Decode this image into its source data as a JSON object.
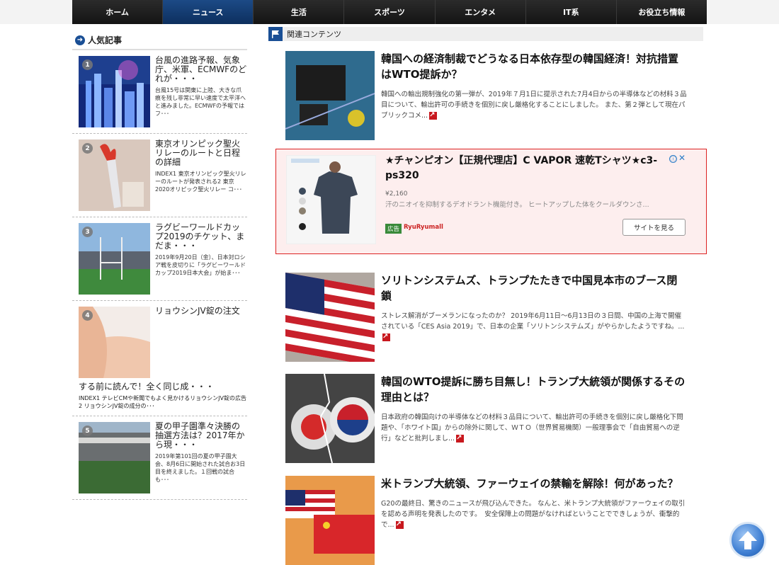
{
  "nav": {
    "items": [
      "ホーム",
      "ニュース",
      "生活",
      "スポーツ",
      "エンタメ",
      "IT系",
      "お役立ち情報"
    ],
    "active_index": 1
  },
  "sidebar": {
    "title": "人気記事",
    "items": [
      {
        "rank": "1",
        "title": "台風の進路予報、気象庁、米軍、ECMWFのどれが・・・",
        "desc": "台風15号は関東に上陸、大きな爪痕を残し非常に早い速度で太平洋へと進みました。ECMWFの予報ではフ･･･"
      },
      {
        "rank": "2",
        "title": "東京オリンピック聖火リレーのルートと日程の詳細",
        "desc": "INDEX1 東京オリンピック聖火リレーのルートが発表される2 東京2020オリピック聖火リレー コ･･･"
      },
      {
        "rank": "3",
        "title": "ラグビーワールドカップ2019のチケット、まだま・・・",
        "desc": "2019年9月20日（金）、日本対ロシア戦を皮切りに「ラグビーワールドカップ2019日本大会」が始ま･･･"
      },
      {
        "rank": "4",
        "title_line1": "リョウシンJV錠の注文",
        "title_line2": "する前に読んで！全く同じ成・・・",
        "desc": "INDEX1 テレビCMや新聞でもよく見かけるリョウシンJV錠の広告2 リョウシンJV錠の成分の･･･"
      },
      {
        "rank": "5",
        "title": "夏の甲子園準々決勝の抽選方法は？2017年から現・・・",
        "desc": "2019年第101回の夏の甲子園大会、8月6日に開始された試合お3日目を終えました。１回戦の試合も･･･"
      }
    ]
  },
  "main": {
    "title": "関連コンテンツ",
    "articles": [
      {
        "title": "韓国への経済制裁でどうなる日本依存型の韓国経済！対抗措置はWTO提訴か？",
        "desc": "韓国への輸出規制強化の第一弾が、2019年７月1日に提示された7月4日からの半導体などの材料３品目について、輸出許可の手続きを個別に戻し厳格化することにしました。 また、第２弾として現在パブリックコメ..."
      },
      {
        "title": "ソリトンシステムズ、トランプたたきで中国見本市のブース閉鎖",
        "desc": "ストレス解消がブーメランになったのか？ 2019年6月11日～6月13日の３日間、中国の上海で開催されている「CES Asia 2019」で、日本の企業「ソリトンシステムズ」がやらかしたようですね。..."
      },
      {
        "title": "韓国のWTO提訴に勝ち目無し！トランプ大統領が関係するその理由とは？",
        "desc": "日本政府の韓国向けの半導体などの材料３品目について、輸出許可の手続きを個別に戻し厳格化下問題や、「ホワイト国」からの除外に関して、ＷＴＯ（世界貿易機関）一般理事会で「自由貿易への逆行」などと批判しまし..."
      },
      {
        "title": "米トランプ大統領、ファーウェイの禁輸を解除！何があった？",
        "desc": "G20の最終日、驚きのニュースが飛び込んできた。 なんと、米トランプ大統領がファーウェイの取引を認める声明を発表したのです。　安全保障上の問題がなければということでできしょうが、衝撃的で..."
      }
    ]
  },
  "ad": {
    "title": "★チャンピオン【正規代理店】C VAPOR 速乾Tシャツ★c3-ps320",
    "price": "¥2,160",
    "desc": "汗のニオイを抑制するデオドラント機能付き。 ヒートアップした体をクールダウンさ...",
    "badge": "広告",
    "brand": "RyuRyumall",
    "button": "サイトを見る",
    "info": "ⓘ",
    "close": "✕"
  },
  "colors": {
    "nav_active": "#0d2f5e",
    "accent_blue": "#1a4f95",
    "ad_border": "#dd2222",
    "more_icon": "#c8181e"
  }
}
